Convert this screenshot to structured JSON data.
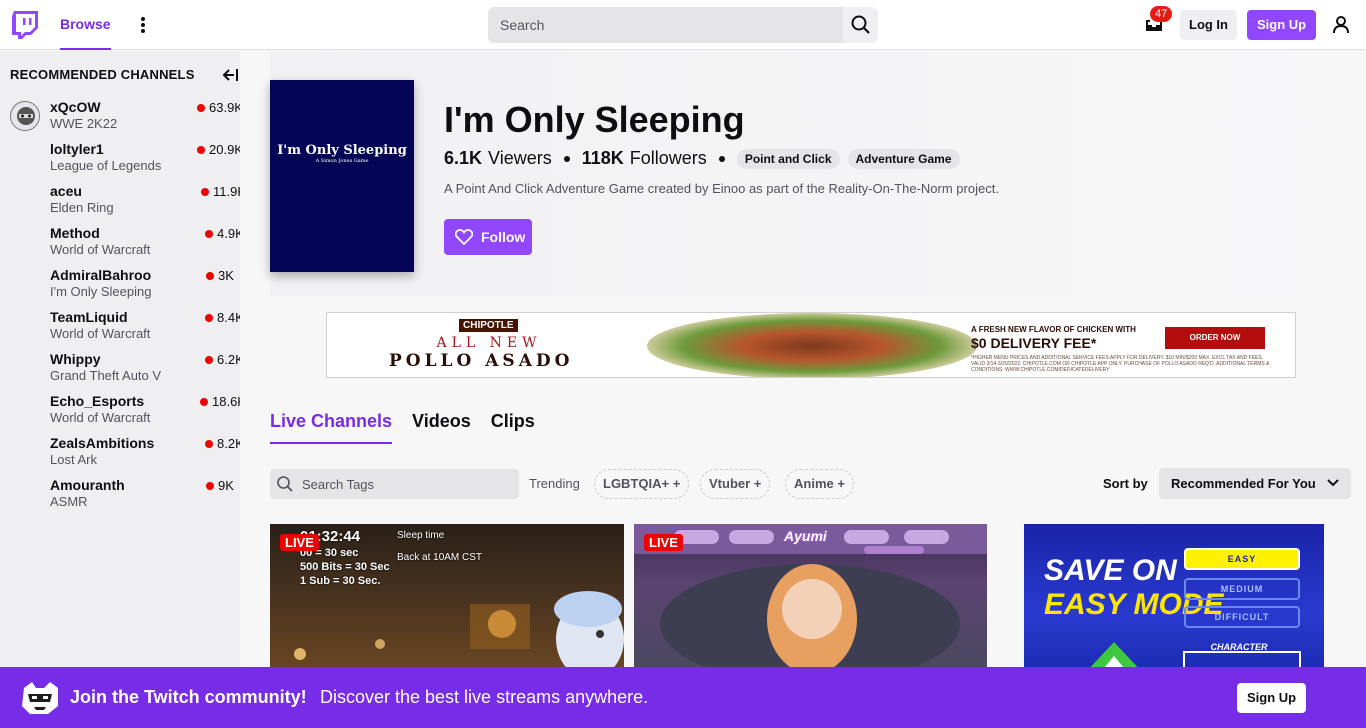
{
  "nav": {
    "browse": "Browse",
    "search_placeholder": "Search",
    "inbox_count": "47",
    "login": "Log In",
    "signup": "Sign Up"
  },
  "sidebar": {
    "heading": "RECOMMENDED CHANNELS",
    "channels": [
      {
        "name": "xQcOW",
        "game": "WWE 2K22",
        "viewers": "63.9K"
      },
      {
        "name": "loltyler1",
        "game": "League of Legends",
        "viewers": "20.9K"
      },
      {
        "name": "aceu",
        "game": "Elden Ring",
        "viewers": "11.9K"
      },
      {
        "name": "Method",
        "game": "World of Warcraft",
        "viewers": "4.9K"
      },
      {
        "name": "AdmiralBahroo",
        "game": "I'm Only Sleeping",
        "viewers": "3K"
      },
      {
        "name": "TeamLiquid",
        "game": "World of Warcraft",
        "viewers": "8.4K"
      },
      {
        "name": "Whippy",
        "game": "Grand Theft Auto V",
        "viewers": "6.2K"
      },
      {
        "name": "Echo_Esports",
        "game": "World of Warcraft",
        "viewers": "18.6K"
      },
      {
        "name": "ZealsAmbitions",
        "game": "Lost Ark",
        "viewers": "8.2K"
      },
      {
        "name": "Amouranth",
        "game": "ASMR",
        "viewers": "9K"
      }
    ]
  },
  "game": {
    "boxart_title": "I'm Only Sleeping",
    "boxart_subtitle": "A Simon Jones Game",
    "title": "I'm Only Sleeping",
    "viewers_value": "6.1K",
    "viewers_label": "Viewers",
    "followers_value": "118K",
    "followers_label": "Followers",
    "tags": [
      "Point and Click",
      "Adventure Game"
    ],
    "description": "A Point And Click Adventure Game created by Einoo as part of the Reality-On-The-Norm project.",
    "follow_label": "Follow"
  },
  "ad": {
    "brand": "CHIPOTLE",
    "line1": "ALL NEW",
    "line2": "POLLO ASADO",
    "fresh": "A FRESH NEW FLAVOR OF CHICKEN WITH",
    "fee": "$0 DELIVERY FEE*",
    "cta": "ORDER NOW",
    "fine": "*HIGHER MENU PRICES AND ADDITIONAL SERVICE FEES APPLY FOR DELIVERY. $10 MIN/$200 MAX. EXCL TAX AND FEES. VALID 3/14-3/20/2022. CHIPOTLE.COM OR CHIPOTLE APP ONLY. PURCHASE OF POLLO ASADO REQ'D. ADDITIONAL TERMS & CONDITIONS: WWW.CHIPOTLE.COM/DEDICATEDELIVERY"
  },
  "tabs": [
    "Live Channels",
    "Videos",
    "Clips"
  ],
  "filters": {
    "tag_search_placeholder": "Search Tags",
    "trending_label": "Trending",
    "chips": [
      "LGBTQIA+",
      "Vtuber",
      "Anime"
    ],
    "sort_label": "Sort by",
    "sort_value": "Recommended For You"
  },
  "thumbnails": {
    "live_label": "LIVE",
    "t1_timer": "01:32:44",
    "t1_lines": [
      "00 = 30 sec",
      "500 Bits = 30 Sec",
      "1 Sub = 30 Sec."
    ],
    "t1_right": [
      "Sleep time",
      "Back at 10AM CST"
    ],
    "t2_logo": "Ayumi",
    "t3_line1": "SAVE ON",
    "t3_line2": "EASY MODE",
    "t3_options": [
      "EASY",
      "MEDIUM",
      "DIFFICULT"
    ],
    "t3_char": "CHARACTER"
  },
  "banner": {
    "join": "Join the Twitch community!",
    "discover": "Discover the best live streams anywhere.",
    "signup": "Sign Up"
  },
  "colors": {
    "accent": "#9147ff",
    "accent_dark": "#772ce8",
    "live_red": "#eb0400"
  }
}
